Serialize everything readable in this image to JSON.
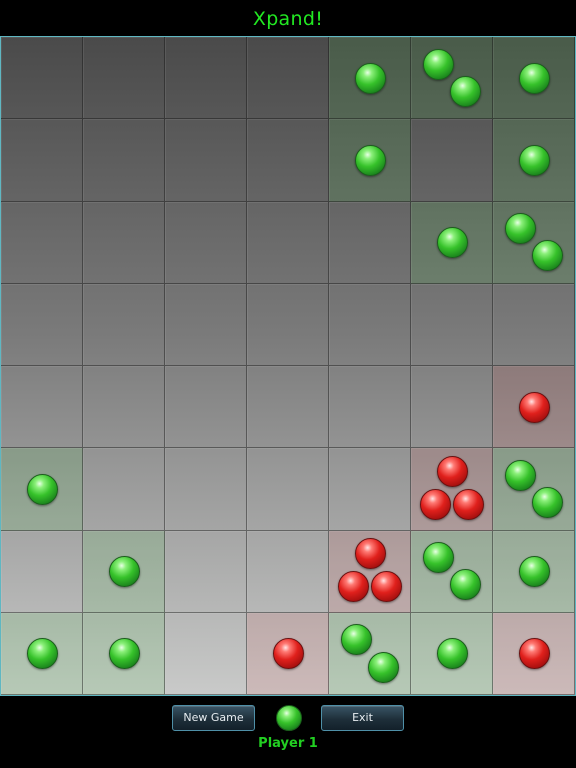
{
  "title": "Xpand!",
  "colors": {
    "green": "#22e822",
    "red": "#e0201c",
    "board_border": "#5fb7c2"
  },
  "board": {
    "rows": 8,
    "cols": 7,
    "cells": [
      [
        null,
        null,
        null,
        null,
        {
          "owner": "green",
          "count": 1
        },
        {
          "owner": "green",
          "count": 2
        },
        {
          "owner": "green",
          "count": 1
        }
      ],
      [
        null,
        null,
        null,
        null,
        {
          "owner": "green",
          "count": 1
        },
        null,
        {
          "owner": "green",
          "count": 1
        }
      ],
      [
        null,
        null,
        null,
        null,
        null,
        {
          "owner": "green",
          "count": 1
        },
        {
          "owner": "green",
          "count": 2
        }
      ],
      [
        null,
        null,
        null,
        null,
        null,
        null,
        null
      ],
      [
        null,
        null,
        null,
        null,
        null,
        null,
        {
          "owner": "red",
          "count": 1
        }
      ],
      [
        {
          "owner": "green",
          "count": 1
        },
        null,
        null,
        null,
        null,
        {
          "owner": "red",
          "count": 3
        },
        {
          "owner": "green",
          "count": 2
        }
      ],
      [
        null,
        {
          "owner": "green",
          "count": 1
        },
        null,
        null,
        {
          "owner": "red",
          "count": 3
        },
        {
          "owner": "green",
          "count": 2
        },
        {
          "owner": "green",
          "count": 1
        }
      ],
      [
        {
          "owner": "green",
          "count": 1
        },
        {
          "owner": "green",
          "count": 1
        },
        null,
        {
          "owner": "red",
          "count": 1
        },
        {
          "owner": "green",
          "count": 2
        },
        {
          "owner": "green",
          "count": 1
        },
        {
          "owner": "red",
          "count": 1
        }
      ]
    ]
  },
  "controls": {
    "new_game_label": "New Game",
    "exit_label": "Exit",
    "current_player_color": "green",
    "current_player_label": "Player 1"
  }
}
